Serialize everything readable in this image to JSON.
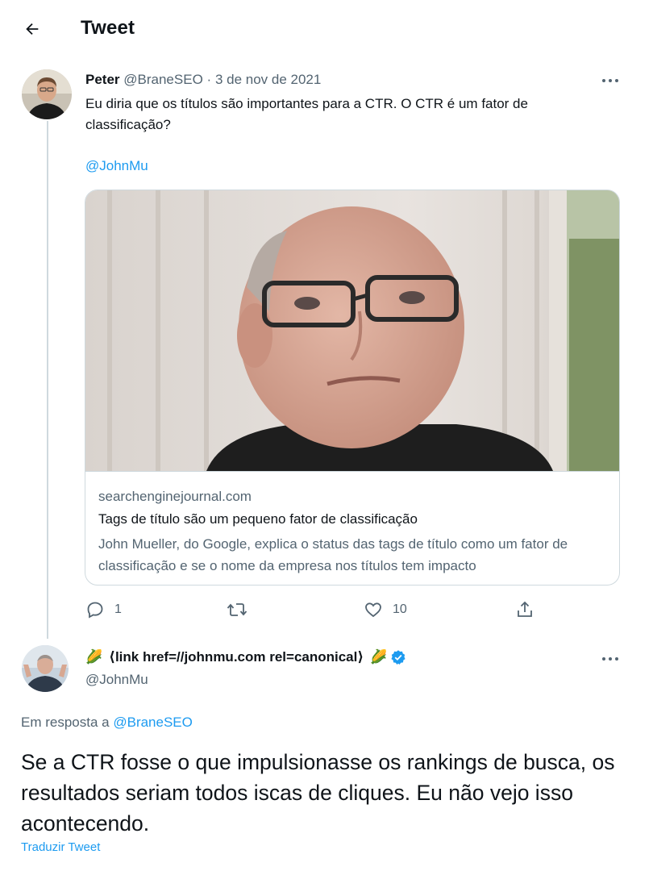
{
  "header": {
    "title": "Tweet",
    "back_icon": "arrow-left-icon"
  },
  "tweet1": {
    "author_name": "Peter",
    "author_handle": "@BraneSEO",
    "separator": "·",
    "date": "3 de nov de 2021",
    "text": "Eu diria que os títulos são importantes para a CTR. O CTR é um fator de classificação?",
    "mention": "@JohnMu",
    "card": {
      "domain": "searchenginejournal.com",
      "title": "Tags de título são um pequeno fator de classificação",
      "description": "John Mueller, do Google, explica o status das tags de título como um fator de classificação e se o nome da empresa nos títulos tem impacto"
    },
    "actions": {
      "reply_icon": "reply-icon",
      "reply_count": "1",
      "retweet_icon": "retweet-icon",
      "like_icon": "heart-icon",
      "like_count": "10",
      "share_icon": "share-icon"
    }
  },
  "tweet2": {
    "emoji_left": "🌽",
    "author_name": "⟨link href=//johnmu.com rel=canonical⟩",
    "emoji_right": "🌽",
    "verified_icon": "verified-badge-icon",
    "author_handle": "@JohnMu",
    "reply_prefix": "Em resposta a",
    "reply_to_handle": "@BraneSEO",
    "text": "Se a CTR fosse o que impulsionasse os rankings de busca, os resultados seriam todos iscas de cliques. Eu não vejo isso acontecendo.",
    "translate_label": "Traduzir Tweet"
  },
  "colors": {
    "accent": "#1d9bf0",
    "text": "#0f1419",
    "muted": "#536471",
    "border": "#cfd9de"
  }
}
